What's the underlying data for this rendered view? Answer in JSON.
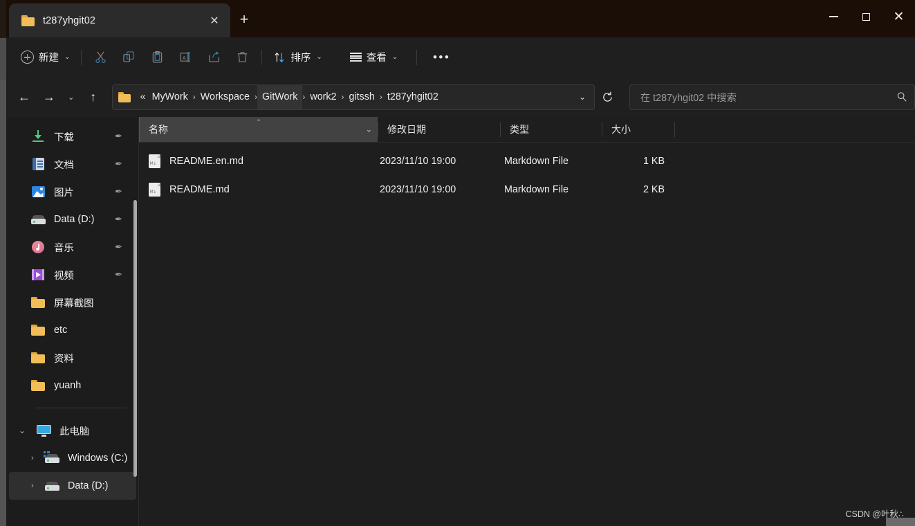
{
  "window": {
    "tab_title": "t287yhgit02",
    "tab_close_label": "✕",
    "new_tab_label": "+",
    "minimize_label": "",
    "maximize_label": "",
    "close_label": "✕"
  },
  "toolbar": {
    "new_label": "新建",
    "new_chevron": "⌄",
    "cut_label": "",
    "copy_label": "",
    "paste_label": "",
    "rename_label": "",
    "share_label": "",
    "delete_label": "",
    "sort_label": "排序",
    "sort_chevron": "⌄",
    "view_label": "查看",
    "view_chevron": "⌄",
    "more_label": "•••"
  },
  "address": {
    "back_label": "←",
    "forward_label": "→",
    "recent_label": "⌄",
    "up_label": "↑",
    "leading": "«",
    "crumbs": [
      "MyWork",
      "Workspace",
      "GitWork",
      "work2",
      "gitssh",
      "t287yhgit02"
    ],
    "highlighted_crumb": "GitWork",
    "separator": "›",
    "dropdown_chevron": "⌄",
    "refresh_label": "⟳"
  },
  "search": {
    "placeholder": "在 t287yhgit02 中搜索",
    "icon_label": "⌕"
  },
  "sidebar": {
    "pin_glyph": "✒",
    "pinned": [
      {
        "label": "下载",
        "icon": "download-icon",
        "pinned": true
      },
      {
        "label": "文档",
        "icon": "documents-icon",
        "pinned": true
      },
      {
        "label": "图片",
        "icon": "pictures-icon",
        "pinned": true
      },
      {
        "label": "Data (D:)",
        "icon": "drive-icon",
        "pinned": true
      },
      {
        "label": "音乐",
        "icon": "music-icon",
        "pinned": true
      },
      {
        "label": "视频",
        "icon": "videos-icon",
        "pinned": true
      },
      {
        "label": "屏幕截图",
        "icon": "folder-icon",
        "pinned": false
      },
      {
        "label": "etc",
        "icon": "folder-icon",
        "pinned": false
      },
      {
        "label": "资料",
        "icon": "folder-icon",
        "pinned": false
      },
      {
        "label": "yuanh",
        "icon": "folder-icon",
        "pinned": false
      }
    ],
    "this_pc": {
      "label": "此电脑",
      "expander": "⌄",
      "children": [
        {
          "label": "Windows (C:)",
          "icon": "windows-drive-icon",
          "expander": "›",
          "selected": false
        },
        {
          "label": "Data (D:)",
          "icon": "drive-icon",
          "expander": "›",
          "selected": true
        }
      ]
    }
  },
  "filelist": {
    "columns": [
      {
        "key": "name",
        "label": "名称",
        "sorted": true,
        "sort_caret": "⌃",
        "dropdown": "⌄"
      },
      {
        "key": "date",
        "label": "修改日期"
      },
      {
        "key": "type",
        "label": "类型"
      },
      {
        "key": "size",
        "label": "大小"
      }
    ],
    "rows": [
      {
        "name": "README.en.md",
        "date": "2023/11/10 19:00",
        "type": "Markdown File",
        "size": "1 KB",
        "icon": "markdown-file-icon",
        "icon_label": "M↓"
      },
      {
        "name": "README.md",
        "date": "2023/11/10 19:00",
        "type": "Markdown File",
        "size": "2 KB",
        "icon": "markdown-file-icon",
        "icon_label": "M↓"
      }
    ]
  },
  "watermark": {
    "text": "CSDN @叶秋∴"
  },
  "colors": {
    "accent_blue": "#4cb3ff",
    "folder_yellow": "#f0bd58",
    "window_bg": "#1f1f1f",
    "titlebar_bg": "#1a0e07",
    "selection_bg": "#2f2f2f"
  }
}
